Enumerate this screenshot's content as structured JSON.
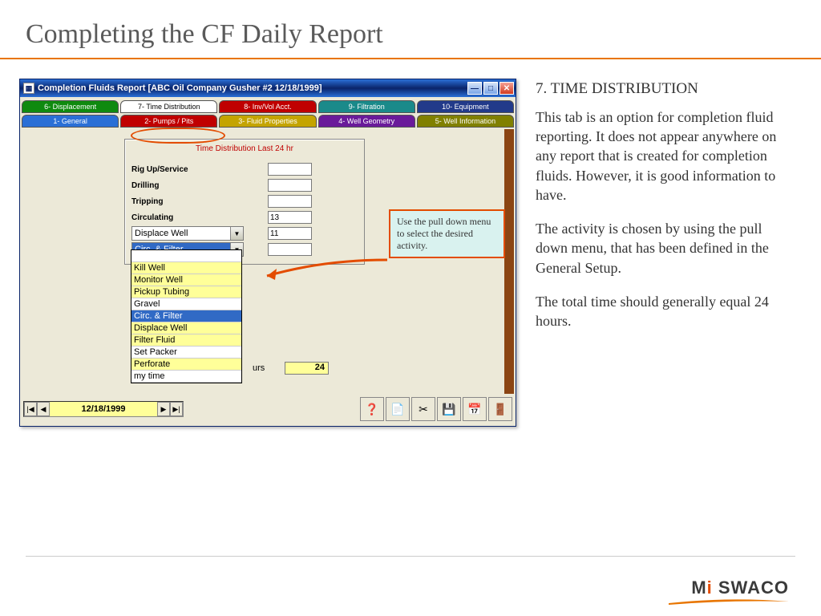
{
  "slide": {
    "title": "Completing the CF Daily Report"
  },
  "window": {
    "title": "Completion Fluids Report [ABC Oil Company  Gusher #2  12/18/1999]",
    "tabs_row1": [
      {
        "label": "6- Displacement",
        "cls": "t-green"
      },
      {
        "label": "7- Time Distribution",
        "cls": "t-white",
        "circled": true
      },
      {
        "label": "8- Inv/Vol Acct.",
        "cls": "t-red"
      },
      {
        "label": "9- Filtration",
        "cls": "t-teal"
      },
      {
        "label": "10- Equipment",
        "cls": "t-navy"
      }
    ],
    "tabs_row2": [
      {
        "label": "1- General",
        "cls": "t-blue"
      },
      {
        "label": "2- Pumps / Pits",
        "cls": "t-red"
      },
      {
        "label": "3- Fluid Properties",
        "cls": "t-yellow"
      },
      {
        "label": "4- Well Geometry",
        "cls": "t-purple"
      },
      {
        "label": "5- Well Information",
        "cls": "t-olive"
      }
    ],
    "panel_title": "Time Distribution Last 24 hr",
    "fixed_rows": [
      {
        "label": "Rig Up/Service",
        "value": ""
      },
      {
        "label": "Drilling",
        "value": ""
      },
      {
        "label": "Tripping",
        "value": ""
      },
      {
        "label": "Circulating",
        "value": "13"
      }
    ],
    "combo1": {
      "text": "Displace Well",
      "value": "11",
      "highlighted": false
    },
    "combo2": {
      "text": "Circ. & Filter",
      "value": "",
      "highlighted": true
    },
    "dropdown_items": [
      {
        "label": "",
        "cls": "white"
      },
      {
        "label": "Kill Well",
        "cls": ""
      },
      {
        "label": "Monitor Well",
        "cls": ""
      },
      {
        "label": "Pickup Tubing",
        "cls": ""
      },
      {
        "label": "Gravel",
        "cls": "white"
      },
      {
        "label": "Circ. & Filter",
        "cls": "sel"
      },
      {
        "label": "Displace Well",
        "cls": ""
      },
      {
        "label": "Filter Fluid",
        "cls": ""
      },
      {
        "label": "Set Packer",
        "cls": "white"
      },
      {
        "label": "Perforate",
        "cls": ""
      },
      {
        "label": "my time",
        "cls": "white"
      }
    ],
    "total": {
      "label": "urs",
      "value": "24"
    },
    "callout": "Use the pull down menu to select  the desired activity.",
    "nav_date": "12/18/1999"
  },
  "right": {
    "heading": "7. TIME DISTRIBUTION",
    "p1": "This tab is an option for completion fluid reporting. It does not appear anywhere on any report that is created for completion fluids. However, it is good information to have.",
    "p2": "The activity is chosen by using the pull down menu, that has been defined in the General Setup.",
    "p3": "The total time should generally equal 24 hours."
  },
  "logo": {
    "pre": "M",
    "i": "i",
    "mid": " SWACO"
  }
}
